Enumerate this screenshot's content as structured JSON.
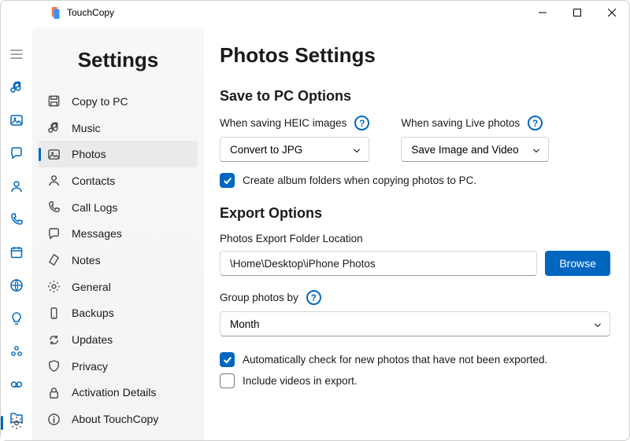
{
  "app": {
    "title": "TouchCopy"
  },
  "iconbar": {
    "items": [
      "menu",
      "music",
      "photos",
      "messages",
      "contacts",
      "call-logs",
      "calendar",
      "internet",
      "notes",
      "voicemail",
      "shared",
      "files"
    ],
    "bottom": "settings"
  },
  "settings_nav": {
    "title": "Settings",
    "items": [
      {
        "id": "copy-to-pc",
        "label": "Copy to PC",
        "icon": "save"
      },
      {
        "id": "music",
        "label": "Music",
        "icon": "music"
      },
      {
        "id": "photos",
        "label": "Photos",
        "icon": "photo",
        "active": true
      },
      {
        "id": "contacts",
        "label": "Contacts",
        "icon": "contact"
      },
      {
        "id": "call-logs",
        "label": "Call Logs",
        "icon": "phone"
      },
      {
        "id": "messages",
        "label": "Messages",
        "icon": "chat"
      },
      {
        "id": "notes",
        "label": "Notes",
        "icon": "note"
      },
      {
        "id": "general",
        "label": "General",
        "icon": "gear"
      },
      {
        "id": "backups",
        "label": "Backups",
        "icon": "device"
      },
      {
        "id": "updates",
        "label": "Updates",
        "icon": "refresh"
      },
      {
        "id": "privacy",
        "label": "Privacy",
        "icon": "shield"
      },
      {
        "id": "activation",
        "label": "Activation Details",
        "icon": "lock"
      },
      {
        "id": "about",
        "label": "About TouchCopy",
        "icon": "info"
      }
    ]
  },
  "page": {
    "title": "Photos Settings",
    "save_section": {
      "title": "Save to PC Options",
      "heic": {
        "label": "When saving HEIC images",
        "value": "Convert to JPG"
      },
      "live": {
        "label": "When saving Live photos",
        "value": "Save Image and Video"
      },
      "albums_cb": {
        "label": "Create album folders when copying photos to PC.",
        "checked": true
      }
    },
    "export_section": {
      "title": "Export Options",
      "folder": {
        "label": "Photos Export Folder Location",
        "value": "\\Home\\Desktop\\iPhone Photos",
        "browse": "Browse"
      },
      "group": {
        "label": "Group photos by",
        "value": "Month"
      },
      "auto_cb": {
        "label": "Automatically check for new photos that have not been exported.",
        "checked": true
      },
      "videos_cb": {
        "label": "Include videos in export.",
        "checked": false
      }
    }
  }
}
